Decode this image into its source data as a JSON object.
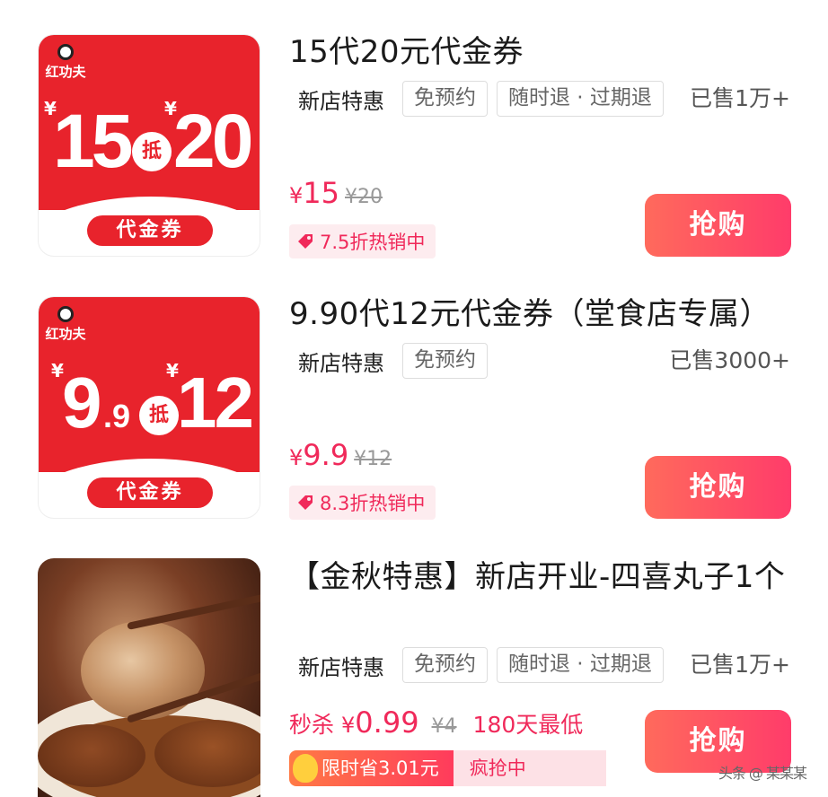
{
  "deals": [
    {
      "title": "15代20元代金券",
      "tags": {
        "new_store": "新店特惠",
        "box1": "免预约",
        "box2": "随时退 · 过期退"
      },
      "sold": "已售1万+",
      "price": "15",
      "original_price": "¥20",
      "currency": "¥",
      "hot_label": "7.5折热销中",
      "buy_label": "抢购",
      "voucher": {
        "logo": "红功夫",
        "left_num": "15",
        "right_num": "20",
        "di": "抵",
        "label": "代金券",
        "yen": "¥"
      }
    },
    {
      "title": "9.90代12元代金券（堂食店专属）",
      "tags": {
        "new_store": "新店特惠",
        "box1": "免预约"
      },
      "sold": "已售3000+",
      "price": "9.9",
      "original_price": "¥12",
      "currency": "¥",
      "hot_label": "8.3折热销中",
      "buy_label": "抢购",
      "voucher": {
        "logo": "红功夫",
        "left_num": "9",
        "left_small": ".9",
        "right_num": "12",
        "di": "抵",
        "label": "代金券",
        "yen": "¥"
      }
    },
    {
      "title": "【金秋特惠】新店开业-四喜丸子1个",
      "tags": {
        "new_store": "新店特惠",
        "box1": "免预约",
        "box2": "随时退 · 过期退"
      },
      "sold": "已售1万+",
      "flash_label": "秒杀",
      "price": "0.99",
      "original_price": "¥4",
      "currency": "¥",
      "lowest_label": "180天最低",
      "promo_left": "限时省3.01元",
      "promo_right": "疯抢中",
      "buy_label": "抢购"
    }
  ],
  "watermark": "头条 @ 某某某",
  "colors": {
    "accent": "#f0295a",
    "voucher_red": "#e8232c",
    "button_start": "#ff6a5c",
    "button_end": "#ff3c6a"
  }
}
